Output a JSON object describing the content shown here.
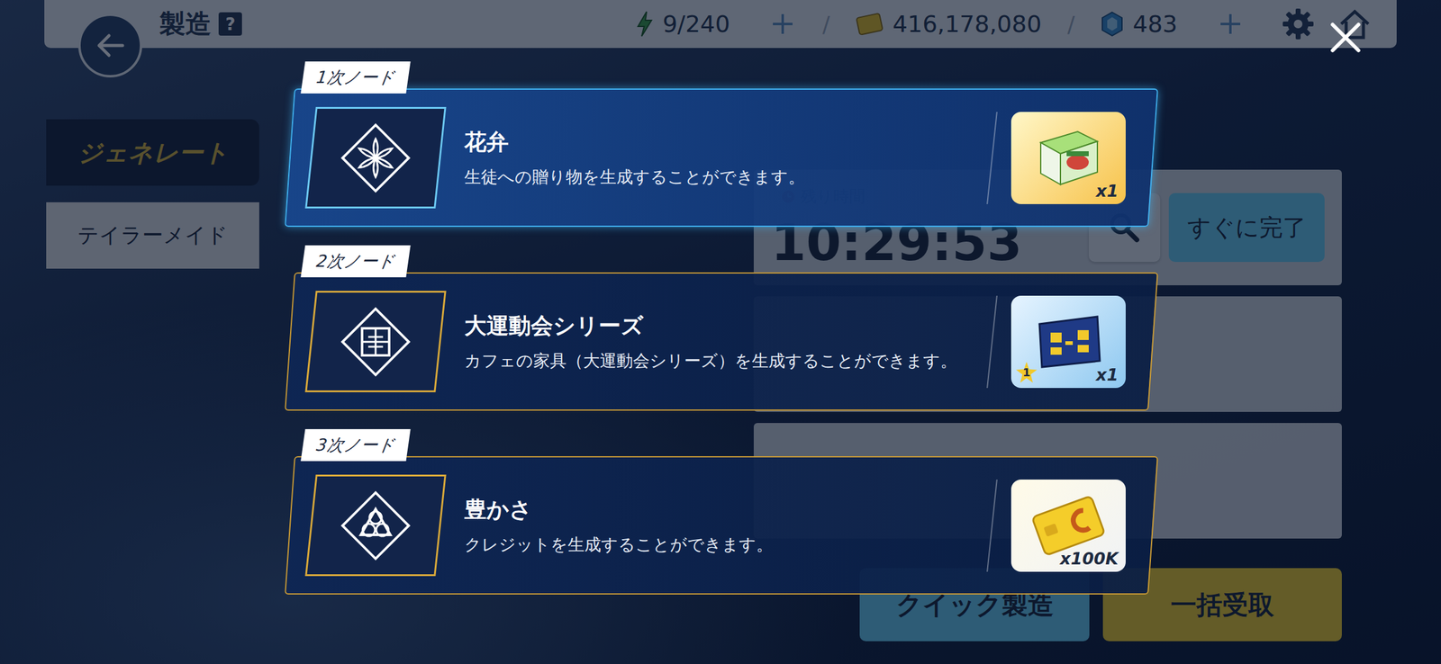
{
  "topbar": {
    "title": "製造",
    "help": "?",
    "separator": "/",
    "resources": [
      {
        "kind": "stamina",
        "value": "9/240",
        "addable": true
      },
      {
        "kind": "credits",
        "value": "416,178,080",
        "addable": false
      },
      {
        "kind": "gems",
        "value": "483",
        "addable": true
      }
    ]
  },
  "tabs": [
    {
      "label": "ジェネレート",
      "selected": true
    },
    {
      "label": "テイラーメイド",
      "selected": false
    }
  ],
  "queue": {
    "slots": [
      {
        "kind": "active",
        "remaining_label": "残り時間",
        "timer": "10:29:53",
        "complete_button": "すぐに完了"
      },
      {
        "kind": "empty"
      },
      {
        "kind": "empty"
      }
    ]
  },
  "actions": [
    {
      "label": "クイック製造",
      "kind": "quick"
    },
    {
      "label": "一括受取",
      "kind": "collect"
    }
  ],
  "nodes": [
    {
      "tier": "1次ノード",
      "title": "花弁",
      "description": "生徒への贈り物を生成することができます。",
      "kind": "gift",
      "reward_count": "x1",
      "selected": true
    },
    {
      "tier": "2次ノード",
      "title": "大運動会シリーズ",
      "description": "カフェの家具（大運動会シリーズ）を生成することができます。",
      "kind": "furniture",
      "reward_count": "x1",
      "rank": "1",
      "selected": false
    },
    {
      "tier": "3次ノード",
      "title": "豊かさ",
      "description": "クレジットを生成することができます。",
      "kind": "credit",
      "reward_count": "x100K",
      "selected": false
    }
  ]
}
